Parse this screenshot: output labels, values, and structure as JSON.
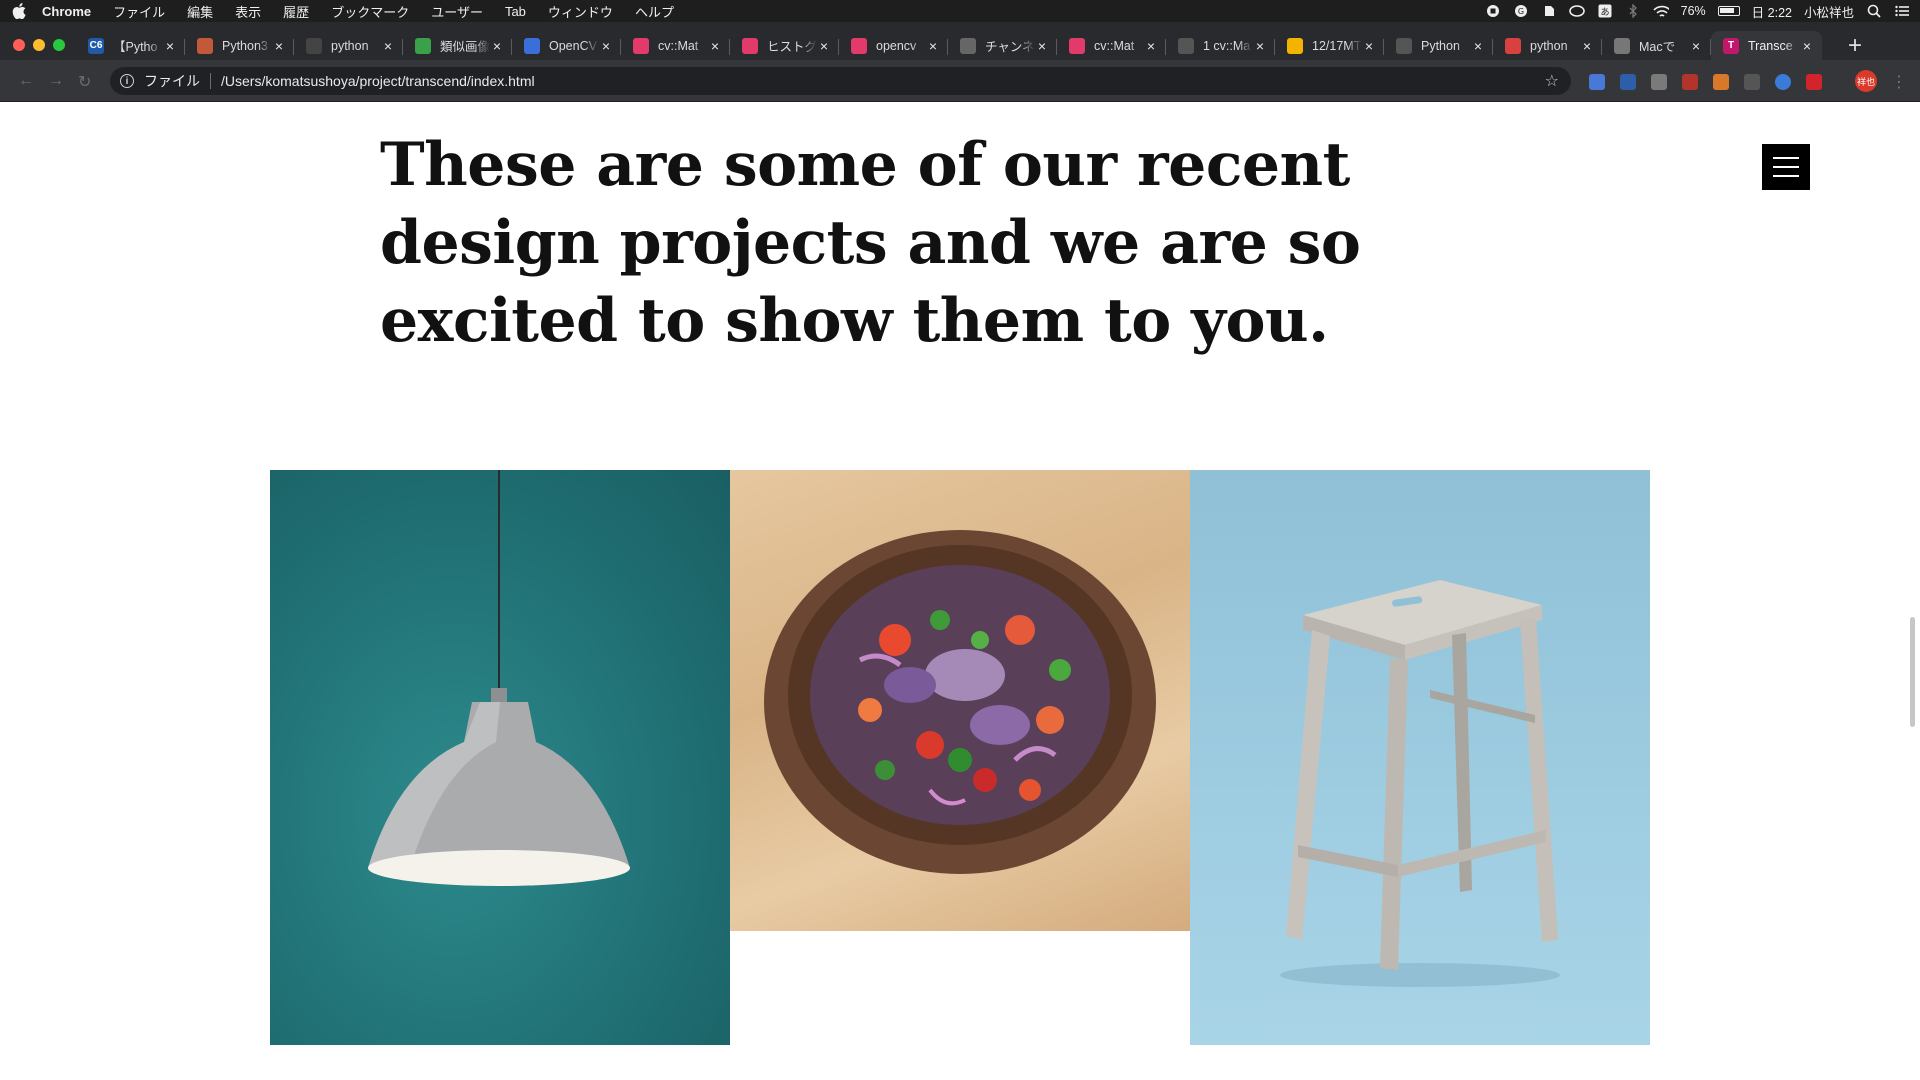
{
  "menubar": {
    "apple_icon": "apple-icon",
    "items": [
      "Chrome",
      "ファイル",
      "編集",
      "表示",
      "履歴",
      "ブックマーク",
      "ユーザー",
      "Tab",
      "ウィンドウ",
      "ヘルプ"
    ],
    "status": {
      "battery": "76%",
      "clock": "日 2:22",
      "user": "小松祥也"
    }
  },
  "tabs": [
    {
      "title": "【Pytho",
      "favicon": "C6",
      "color": "#1e5aa8"
    },
    {
      "title": "Python3",
      "favicon": "",
      "color": "#c25a3a"
    },
    {
      "title": "python",
      "favicon": "",
      "color": "#444"
    },
    {
      "title": "類似画像",
      "favicon": "",
      "color": "#3aa14a"
    },
    {
      "title": "OpenCV",
      "favicon": "",
      "color": "#3a6ed8"
    },
    {
      "title": "cv::Mat",
      "favicon": "",
      "color": "#e23b6b"
    },
    {
      "title": "ヒストグ",
      "favicon": "",
      "color": "#e23b6b"
    },
    {
      "title": "opencv",
      "favicon": "",
      "color": "#e23b6b"
    },
    {
      "title": "チャンネ",
      "favicon": "",
      "color": "#666"
    },
    {
      "title": "cv::Mat",
      "favicon": "",
      "color": "#e23b6b"
    },
    {
      "title": "1 cv::Ma",
      "favicon": "",
      "color": "#555"
    },
    {
      "title": "12/17MT",
      "favicon": "",
      "color": "#f3b400"
    },
    {
      "title": "Python",
      "favicon": "",
      "color": "#555"
    },
    {
      "title": "python",
      "favicon": "",
      "color": "#d94141"
    },
    {
      "title": "Macで",
      "favicon": "",
      "color": "#777"
    },
    {
      "title": "Transce",
      "favicon": "T",
      "color": "#c2186b"
    }
  ],
  "toolbar": {
    "scheme_label": "ファイル",
    "url": "/Users/komatsushoya/project/transcend/index.html",
    "profile_label": "祥也"
  },
  "page": {
    "headline": "These are some of our recent design projects and we are so excited to show them to you.",
    "menu_icon": "hamburger-menu-icon",
    "gallery": [
      {
        "name": "pendant-lamp-photo",
        "subject": "pendant lamp on teal wall"
      },
      {
        "name": "salad-bowl-photo",
        "subject": "salad bowl on wooden table"
      },
      {
        "name": "wooden-stool-photo",
        "subject": "wooden stool on blue background"
      }
    ]
  }
}
